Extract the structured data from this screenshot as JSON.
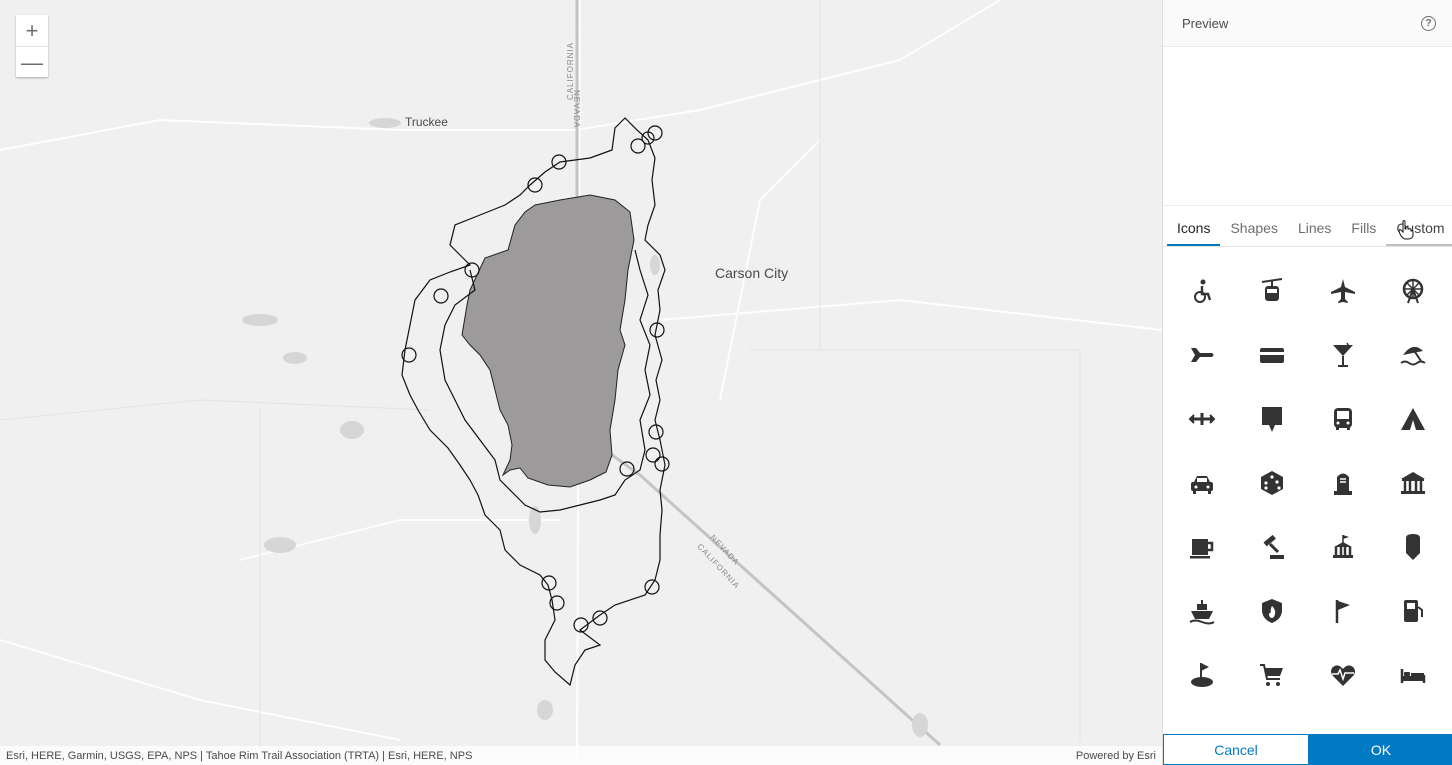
{
  "map": {
    "zoom_in_label": "+",
    "zoom_out_label": "—",
    "places": [
      {
        "name": "Truckee"
      },
      {
        "name": "Carson City"
      }
    ],
    "boundary_labels": [
      "CALIFORNIA",
      "NEVADA",
      "NEVADA",
      "CALIFORNIA"
    ],
    "attribution": "Esri, HERE, Garmin, USGS, EPA, NPS | Tahoe Rim Trail Association (TRTA) | Esri, HERE, NPS",
    "powered_by": "Powered by Esri",
    "colors": {
      "lake_fill": "#9c9a9b",
      "trail_stroke": "#111111",
      "background": "#f0f0f0"
    }
  },
  "panel": {
    "title": "Preview",
    "help_icon": "question-circle-icon",
    "tabs": [
      {
        "label": "Icons",
        "active": true
      },
      {
        "label": "Shapes",
        "active": false
      },
      {
        "label": "Lines",
        "active": false
      },
      {
        "label": "Fills",
        "active": false
      },
      {
        "label": "Custom",
        "active": false
      }
    ],
    "icons": [
      "accessibility-icon",
      "aerial-tram-icon",
      "airplane-icon",
      "amusement-park-icon",
      "airport-arrival-icon",
      "atm-card-icon",
      "cocktail-bar-icon",
      "beach-icon",
      "bridge-icon",
      "speech-marker-icon",
      "bus-icon",
      "campground-icon",
      "car-rental-icon",
      "dice-casino-icon",
      "cemetery-icon",
      "city-hall-icon",
      "coffee-icon",
      "courthouse-icon",
      "embassy-icon",
      "marker-icon",
      "ferry-icon",
      "fire-station-icon",
      "flag-icon",
      "gas-station-icon",
      "golf-icon",
      "shopping-cart-icon",
      "hospital-heart-icon",
      "lodging-bed-icon"
    ],
    "cancel_label": "Cancel",
    "ok_label": "OK",
    "accent_color": "#007ac2"
  }
}
